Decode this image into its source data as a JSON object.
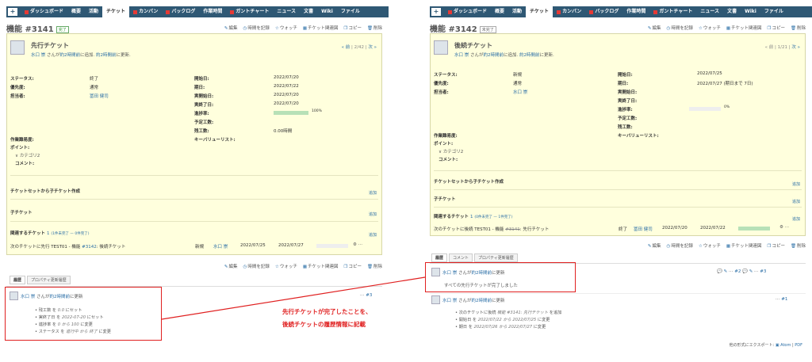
{
  "nav": [
    "ダッシュボード",
    "概要",
    "活動",
    "チケット",
    "カンバン",
    "バックログ",
    "作業時間",
    "ガントチャート",
    "ニュース",
    "文書",
    "Wiki",
    "ファイル"
  ],
  "left": {
    "title": "機能 #3141",
    "badge": "完了",
    "subject": "先行チケット",
    "author": {
      "name": "水口 崇",
      "mid": " さんが",
      "ago": "約2時間前",
      "added": "に追加. ",
      "ago2": "約2時間前",
      "updated": "に更新."
    },
    "pager": {
      "prev": "« 前",
      "pos": "2/42",
      "next": "次 »"
    },
    "toolbar": [
      "編集",
      "時間を記録",
      "ウォッチ",
      "チケット関連図",
      "コピー",
      "削除"
    ],
    "fields": {
      "status_l": "ステータス:",
      "status": "終了",
      "priority_l": "優先度:",
      "priority": "通常",
      "assignee_l": "担当者:",
      "assignee": "冨田 健司",
      "start_l": "開始日:",
      "start": "2022/07/20",
      "due_l": "期日:",
      "due": "2022/07/22",
      "astart_l": "実開始日:",
      "astart": "2022/07/20",
      "aend_l": "実終了日:",
      "aend": "2022/07/20",
      "progress_l": "進捗率:",
      "progress": "100%",
      "progress_value": 100,
      "est_l": "予定工数:",
      "remain_l": "残工数:",
      "remain": "0.00時間",
      "kvl_l": "キーバリューリスト:",
      "diff_l": "作業難易度:",
      "point_l": "ポイント:",
      "cat_l": "∨ カテゴリ2",
      "comment_l": "コメント:"
    },
    "sections": {
      "set": "チケットセットから子チケット作成",
      "child": "子チケット",
      "related": "関連するチケット",
      "add": "追加",
      "related_count": "1",
      "related_status": "(1件未完了 — 0件完了)"
    },
    "rel": {
      "text": "次のチケットに先行 TEST01 - 機能",
      "link": "#3142",
      "rest": ": 後続チケット",
      "status": "新規",
      "user": "水口 崇",
      "d1": "2022/07/25",
      "d2": "2022/07/27"
    },
    "tabs": [
      "履歴",
      "プロパティ更新履歴"
    ],
    "journal": {
      "name": "水口 崇",
      "mid": " さんが",
      "ago": "約2時間前",
      "tail": "に更新",
      "no": "#3"
    },
    "changes": [
      [
        "• 残工数 を ",
        "0.0",
        " にセット"
      ],
      [
        "• 実終了日 を ",
        "2022-07-20",
        " にセット"
      ],
      [
        "• 進捗率 を ",
        "0 から 100",
        " に変更"
      ],
      [
        "• ステータス を ",
        "進行中 から 終了",
        " に変更"
      ]
    ]
  },
  "right": {
    "title": "機能 #3142",
    "badge": "未完了",
    "subject": "後続チケット",
    "author": {
      "name": "水口 崇",
      "mid": " さんが",
      "ago": "約2時間前",
      "added": "に追加. ",
      "ago2": "約2時間前",
      "updated": "に更新."
    },
    "pager": {
      "prev": "« 前",
      "pos": "1/21",
      "next": "次 »"
    },
    "toolbar": [
      "編集",
      "時間を記録",
      "ウォッチ",
      "チケット関連図",
      "コピー",
      "削除"
    ],
    "fields": {
      "status_l": "ステータス:",
      "status": "新規",
      "priority_l": "優先度:",
      "priority": "通常",
      "assignee_l": "担当者:",
      "assignee": "水口 崇",
      "start_l": "開始日:",
      "start": "2022/07/25",
      "due_l": "期日:",
      "due": "2022/07/27 (期日まで 7日)",
      "astart_l": "実開始日:",
      "aend_l": "実終了日:",
      "progress_l": "進捗率:",
      "progress": "0%",
      "progress_value": 0,
      "est_l": "予定工数:",
      "remain_l": "残工数:",
      "kvl_l": "キーバリューリスト:",
      "diff_l": "作業難易度:",
      "point_l": "ポイント:",
      "cat_l": "∨ カテゴリ2",
      "comment_l": "コメント:"
    },
    "sections": {
      "set": "チケットセットから子チケット作成",
      "child": "子チケット",
      "related": "関連するチケット",
      "add": "追加",
      "related_count": "1",
      "related_status": "(0件未完了 — 1件完了)"
    },
    "rel": {
      "text": "次のチケットに後続 TEST01 - 機能",
      "link": "#3141",
      "rest": ": 先行チケット",
      "status": "終了",
      "user": "冨田 健司",
      "d1": "2022/07/20",
      "d2": "2022/07/22"
    },
    "tabs": [
      "履歴",
      "コメント",
      "プロパティ更新履歴"
    ],
    "journal1": {
      "name": "水口 崇",
      "mid": " さんが",
      "ago": "約2時間前",
      "tail": "に更新",
      "no": "#2",
      "no2": "#3",
      "body": "すべての先行チケットが完了しました"
    },
    "journal2": {
      "name": "水口 崇",
      "mid": " さんが",
      "ago": "約2時間前",
      "tail": "に更新",
      "no": "#1"
    },
    "changes": [
      [
        "• 次のチケットに後続 ",
        "機能 #3141: 先行チケット",
        " を追加"
      ],
      [
        "• 開始日 を ",
        "2022/07/22 から 2022/07/25",
        " に変更"
      ],
      [
        "• 期日 を ",
        "2022/07/26 から 2022/07/27",
        " に変更"
      ]
    ],
    "export": "他の形式にエクスポート: ",
    "atom": "Atom",
    "pdf": "PDF"
  },
  "annotation": {
    "line1": "先行チケットが完了したことを、",
    "line2": "後続チケットの履歴情報に記載"
  },
  "colors": {
    "nav": "#2f5874",
    "issue_bg": "#ffffdd",
    "accent": "#e02020",
    "link": "#2a6ea6"
  }
}
